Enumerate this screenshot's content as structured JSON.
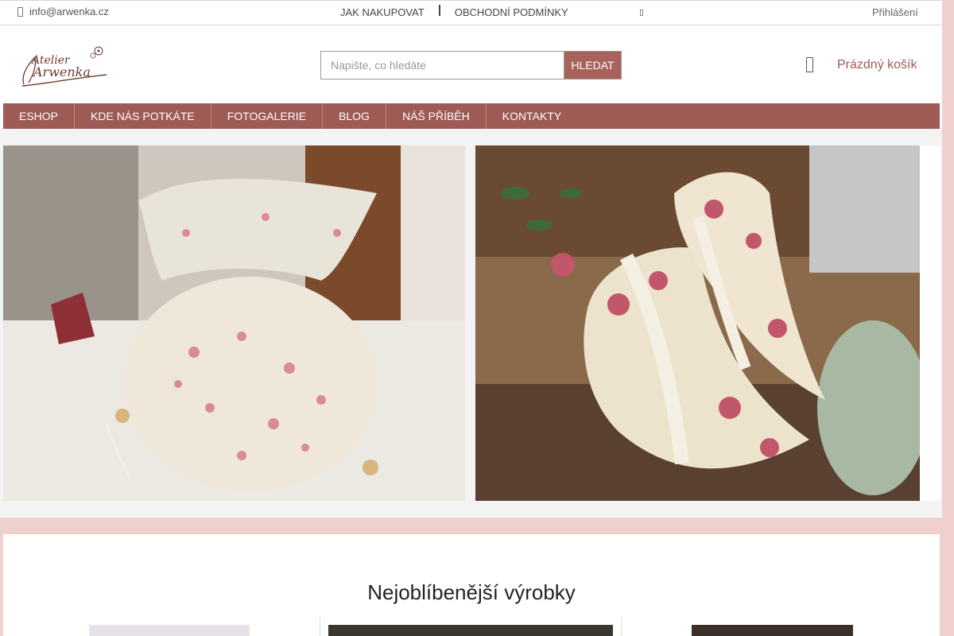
{
  "topbar": {
    "email": "info@arwenka.cz",
    "links": [
      "JAK NAKUPOVAT",
      "OBCHODNÍ PODMÍNKY"
    ],
    "login": "Přihlášení"
  },
  "header": {
    "logo_text": [
      "Atelier",
      "Arwenka"
    ],
    "search_placeholder": "Napište, co hledáte",
    "search_button": "HLEDAT",
    "cart_label": "Prázdný košík"
  },
  "nav": {
    "items": [
      "ESHOP",
      "KDE NÁS POTKÁTE",
      "FOTOGALERIE",
      "BLOG",
      "NÁŠ PŘÍBĚH",
      "KONTAKTY"
    ]
  },
  "main": {
    "section_title": "Nejoblíbenější výrobky"
  },
  "colors": {
    "accent": "#9e5a55",
    "button": "#a8625c",
    "background": "#efd0cc"
  },
  "icons": {
    "email": "envelope-icon",
    "cart": "shopping-cart-icon",
    "topbar_extra": "social-icon"
  }
}
